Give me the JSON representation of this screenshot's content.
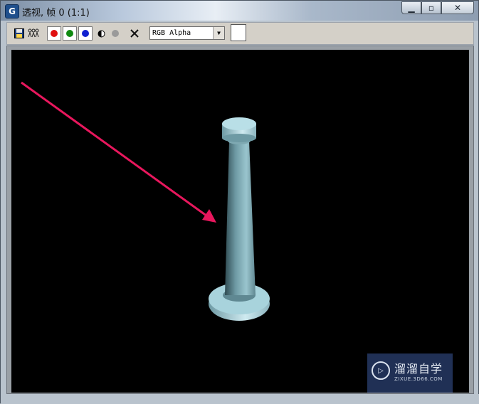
{
  "window": {
    "app_icon_letter": "G",
    "title": "透视, 帧 0 (1:1)",
    "min_symbol": "▁",
    "max_symbol": "▫",
    "close_symbol": "✕"
  },
  "toolbar": {
    "channel_select": {
      "value": "RGB Alpha"
    },
    "colors": {
      "red": "#e01010",
      "green": "#108a10",
      "blue": "#1020d0"
    }
  },
  "watermark": {
    "logo_glyph": "▷",
    "title": "溜溜自学",
    "subtitle": "ZIXUE.3D66.COM"
  },
  "render": {
    "arrow_color": "#e8175d",
    "column_color": "#8fbcc6"
  }
}
